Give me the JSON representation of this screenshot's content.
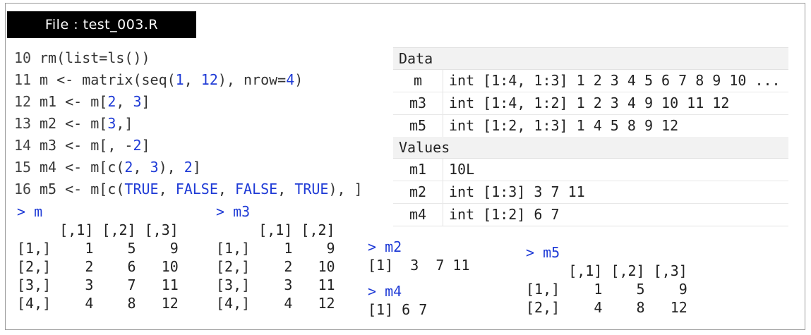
{
  "file_label": "File : test_003.R",
  "code_lines": [
    {
      "n": "10",
      "parts": [
        [
          "t",
          "rm(list=ls())"
        ]
      ]
    },
    {
      "n": "11",
      "parts": [
        [
          "t",
          "m <- matrix(seq("
        ],
        [
          "n",
          "1"
        ],
        [
          "t",
          ", "
        ],
        [
          "n",
          "12"
        ],
        [
          "t",
          "), nrow="
        ],
        [
          "n",
          "4"
        ],
        [
          "t",
          ")"
        ]
      ]
    },
    {
      "n": "12",
      "parts": [
        [
          "t",
          "m1 <- m["
        ],
        [
          "n",
          "2"
        ],
        [
          "t",
          ", "
        ],
        [
          "n",
          "3"
        ],
        [
          "t",
          "]"
        ]
      ]
    },
    {
      "n": "13",
      "parts": [
        [
          "t",
          "m2 <- m["
        ],
        [
          "n",
          "3"
        ],
        [
          "t",
          ",]"
        ]
      ]
    },
    {
      "n": "14",
      "parts": [
        [
          "t",
          "m3 <- m[, -"
        ],
        [
          "n",
          "2"
        ],
        [
          "t",
          "]"
        ]
      ]
    },
    {
      "n": "15",
      "parts": [
        [
          "t",
          "m4 <- m[c("
        ],
        [
          "n",
          "2"
        ],
        [
          "t",
          ", "
        ],
        [
          "n",
          "3"
        ],
        [
          "t",
          "), "
        ],
        [
          "n",
          "2"
        ],
        [
          "t",
          "]"
        ]
      ]
    },
    {
      "n": "16",
      "parts": [
        [
          "t",
          "m5 <- m[c("
        ],
        [
          "n",
          "TRUE"
        ],
        [
          "t",
          ", "
        ],
        [
          "n",
          "FALSE"
        ],
        [
          "t",
          ", "
        ],
        [
          "n",
          "FALSE"
        ],
        [
          "t",
          ", "
        ],
        [
          "n",
          "TRUE"
        ],
        [
          "t",
          "), ]"
        ]
      ]
    }
  ],
  "environment": {
    "data_header": "Data",
    "data_rows": [
      {
        "name": "m",
        "value": "int [1:4, 1:3] 1 2 3 4 5 6 7 8 9 10 ..."
      },
      {
        "name": "m3",
        "value": "int [1:4, 1:2] 1 2 3 4 9 10 11 12"
      },
      {
        "name": "m5",
        "value": "int [1:2, 1:3] 1 4 5 8 9 12"
      }
    ],
    "values_header": "Values",
    "value_rows": [
      {
        "name": "m1",
        "value": "10L"
      },
      {
        "name": "m2",
        "value": "int [1:3] 3 7 11"
      },
      {
        "name": "m4",
        "value": "int [1:2] 6 7"
      }
    ]
  },
  "console": {
    "m": {
      "prompt": "> m",
      "lines": [
        "     [,1] [,2] [,3]",
        "[1,]    1    5    9",
        "[2,]    2    6   10",
        "[3,]    3    7   11",
        "[4,]    4    8   12"
      ]
    },
    "m3": {
      "prompt": "> m3",
      "lines": [
        "     [,1] [,2]",
        "[1,]    1    9",
        "[2,]    2   10",
        "[3,]    3   11",
        "[4,]    4   12"
      ]
    },
    "m2": {
      "prompt": "> m2",
      "lines": [
        "[1]  3  7 11"
      ]
    },
    "m4": {
      "prompt": "> m4",
      "lines": [
        "[1] 6 7"
      ]
    },
    "m5": {
      "prompt": "> m5",
      "lines": [
        "     [,1] [,2] [,3]",
        "[1,]    1    5    9",
        "[2,]    4    8   12"
      ]
    }
  }
}
